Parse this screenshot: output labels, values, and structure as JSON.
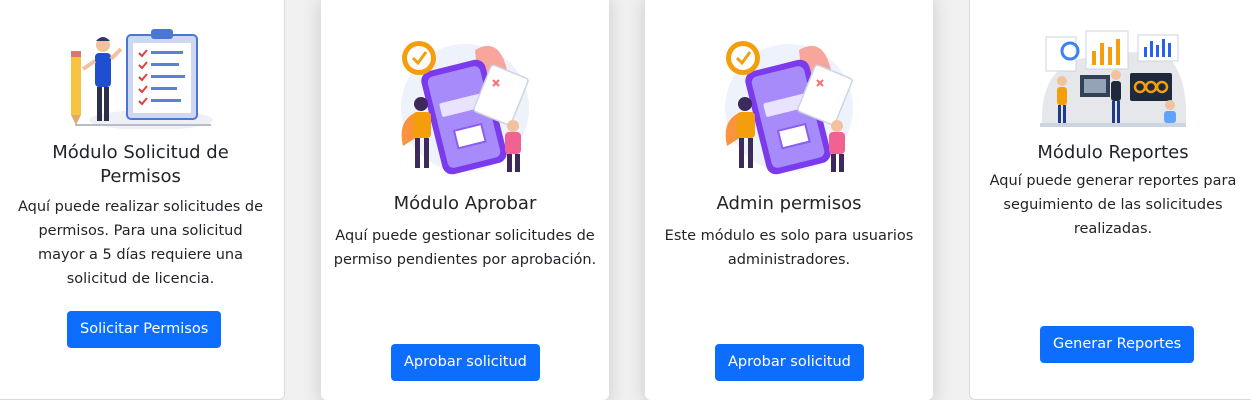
{
  "cards": [
    {
      "title": "Módulo Solicitud de Permisos",
      "description": "Aquí puede realizar solicitudes de permisos. Para una solicitud mayor a 5 días requiere una solicitud de licencia.",
      "button": "Solicitar Permisos"
    },
    {
      "title": "Módulo Aprobar",
      "description": "Aquí puede gestionar solicitudes de permiso pendientes por aprobación.",
      "button": "Aprobar solicitud"
    },
    {
      "title": "Admin permisos",
      "description": "Este módulo es solo para usuarios administradores.",
      "button": "Aprobar solicitud"
    },
    {
      "title": "Módulo Reportes",
      "description": "Aquí puede generar reportes para seguimiento de las solicitudes realizadas.",
      "button": "Generar Reportes"
    }
  ],
  "colors": {
    "primary": "#0d6efd",
    "accent_purple": "#8b5cf6",
    "accent_orange": "#f59e0b"
  },
  "icons": [
    "clipboard-checklist-icon",
    "phone-approval-icon",
    "phone-approval-icon",
    "dashboard-team-icon"
  ]
}
